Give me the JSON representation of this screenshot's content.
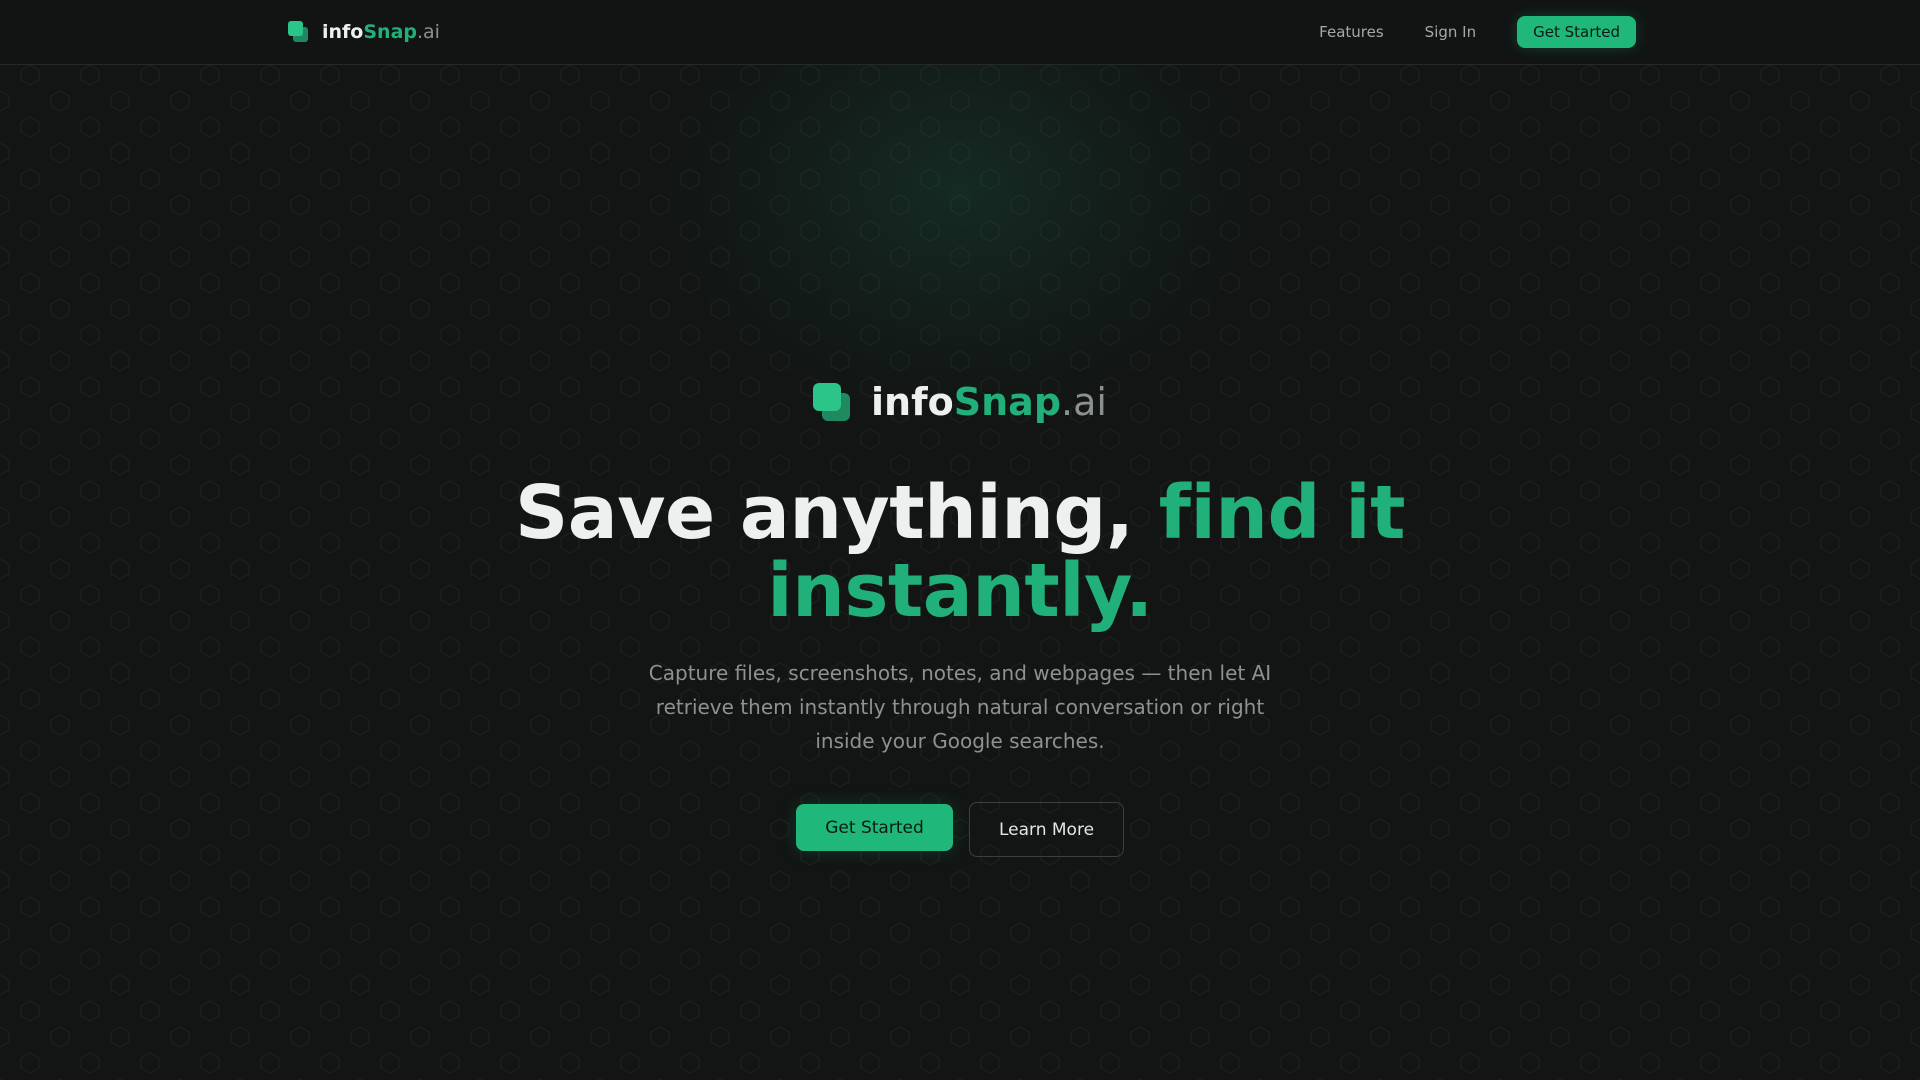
{
  "brand": {
    "name_part1": "info",
    "name_part2": "Snap",
    "name_part3": ".ai",
    "icon": "stacked-squares-logo-icon"
  },
  "nav": {
    "links": [
      {
        "label": "Features"
      },
      {
        "label": "Sign In"
      }
    ],
    "cta_label": "Get Started"
  },
  "hero": {
    "headline_white": "Save anything, ",
    "headline_green": "find it instantly.",
    "subtitle": "Capture files, screenshots, notes, and webpages — then let AI retrieve them instantly through natural conversation or right inside your Google searches.",
    "primary_cta": "Get Started",
    "secondary_cta": "Learn More"
  },
  "colors": {
    "background": "#121514",
    "accent": "#20b77a",
    "text_primary": "#eef0ef",
    "text_muted": "#8c928f"
  }
}
